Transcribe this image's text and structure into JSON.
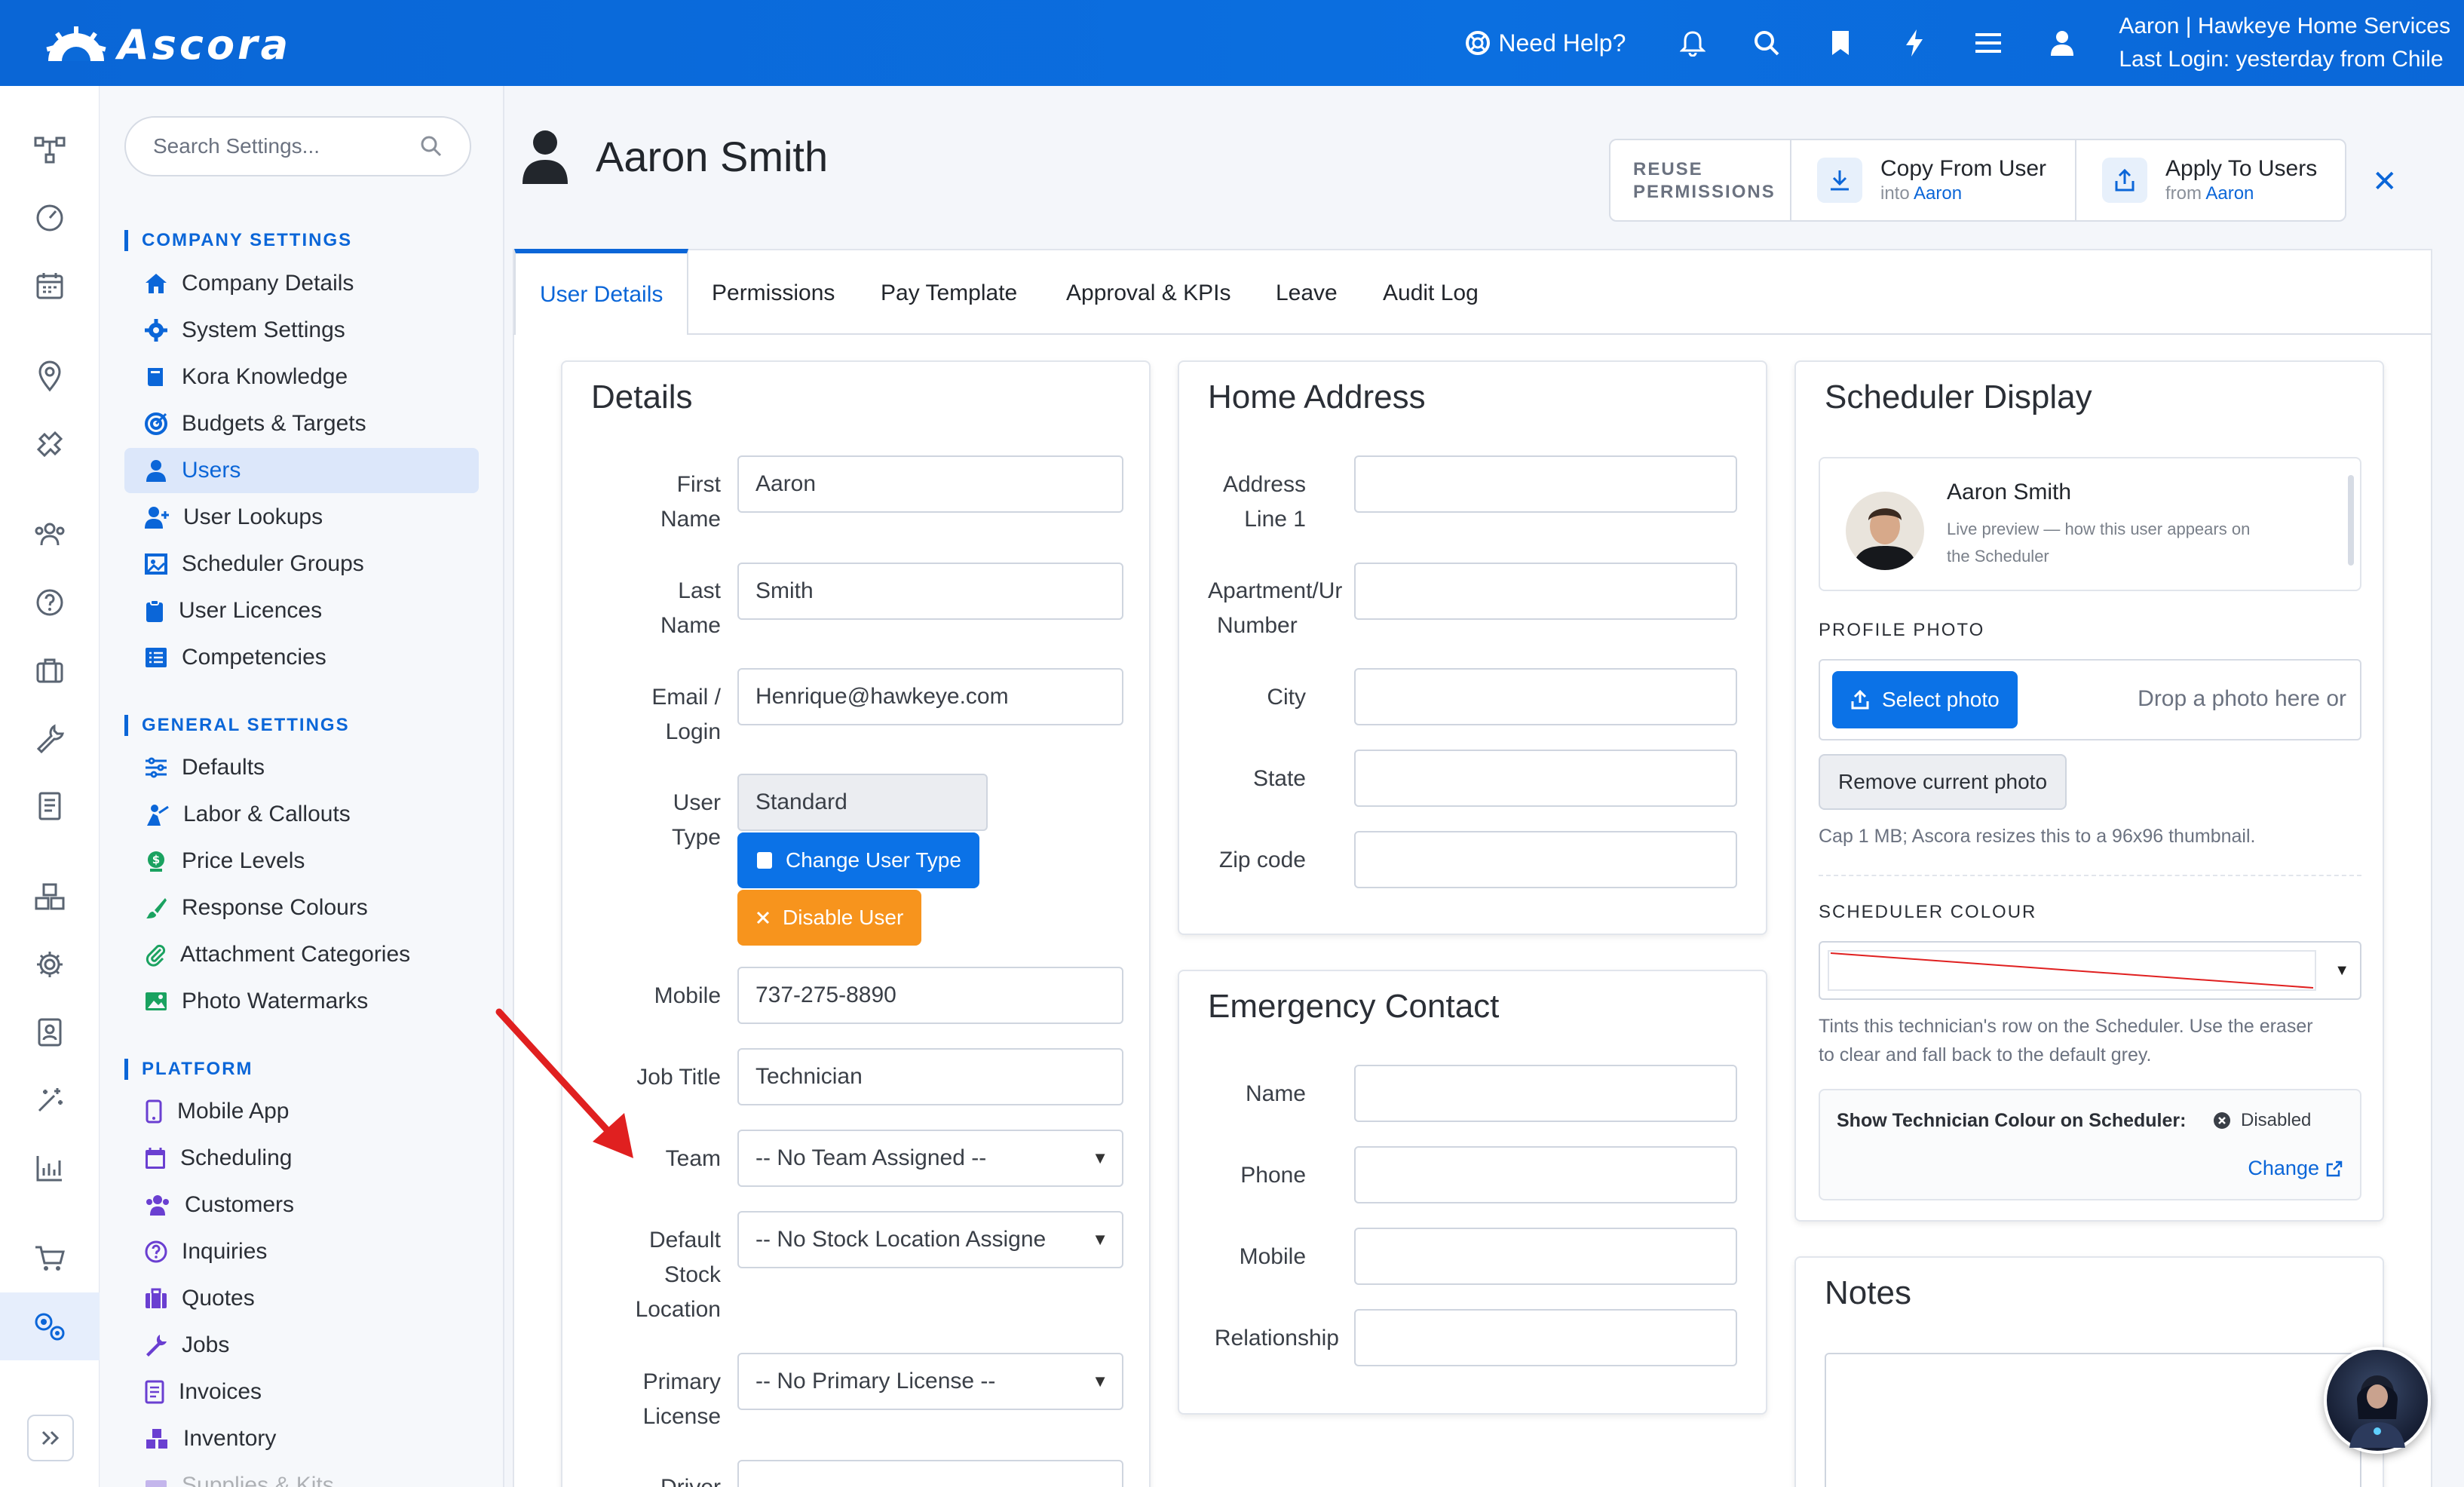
{
  "brand": {
    "name": "Ascora"
  },
  "topbar": {
    "help_label": "Need Help?",
    "user_line1": "Aaron | Hawkeye Home Services",
    "user_line2": "Last Login: yesterday from Chile",
    "icons": [
      "bell-icon",
      "search-icon",
      "bookmark-icon",
      "lightning-icon",
      "menu-icon",
      "user-icon"
    ]
  },
  "search": {
    "placeholder": "Search Settings..."
  },
  "nav": {
    "company_title": "COMPANY SETTINGS",
    "company": [
      "Company Details",
      "System Settings",
      "Kora Knowledge",
      "Budgets & Targets",
      "Users",
      "User Lookups",
      "Scheduler Groups",
      "User Licences",
      "Competencies"
    ],
    "general_title": "GENERAL SETTINGS",
    "general": [
      "Defaults",
      "Labor & Callouts",
      "Price Levels",
      "Response Colours",
      "Attachment Categories",
      "Photo Watermarks"
    ],
    "platform_title": "PLATFORM",
    "platform": [
      "Mobile App",
      "Scheduling",
      "Customers",
      "Inquiries",
      "Quotes",
      "Jobs",
      "Invoices",
      "Inventory",
      "Supplies & Kits"
    ],
    "active": "Users"
  },
  "page": {
    "title": "Aaron Smith"
  },
  "reuse": {
    "label_line1": "REUSE",
    "label_line2": "PERMISSIONS",
    "copy_title": "Copy From User",
    "copy_sub_prefix": "into",
    "copy_sub_name": "Aaron",
    "apply_title": "Apply To Users",
    "apply_sub_prefix": "from",
    "apply_sub_name": "Aaron"
  },
  "tabs": [
    "User Details",
    "Permissions",
    "Pay Template",
    "Approval & KPIs",
    "Leave",
    "Audit Log"
  ],
  "details": {
    "title": "Details",
    "first_name_label_1": "First",
    "first_name_label_2": "Name",
    "first_name": "Aaron",
    "last_name_label_1": "Last",
    "last_name_label_2": "Name",
    "last_name": "Smith",
    "email_label_1": "Email /",
    "email_label_2": "Login",
    "email": "Henrique@hawkeye.com",
    "user_type_label_1": "User",
    "user_type_label_2": "Type",
    "user_type": "Standard",
    "change_type_btn": "Change User Type",
    "disable_btn": "Disable User",
    "mobile_label": "Mobile",
    "mobile": "737-275-8890",
    "job_title_label": "Job Title",
    "job_title": "Technician",
    "team_label": "Team",
    "team": "-- No Team Assigned --",
    "stock_label_1": "Default",
    "stock_label_2": "Stock",
    "stock_label_3": "Location",
    "stock": "-- No Stock Location Assigne",
    "license_label_1": "Primary",
    "license_label_2": "License",
    "license": "-- No Primary License --",
    "driver_label": "Driver"
  },
  "home": {
    "title": "Home Address",
    "addr1_label_1": "Address",
    "addr1_label_2": "Line 1",
    "apt_label_1": "Apartment/Ur",
    "apt_label_2": "Number",
    "city_label": "City",
    "state_label": "State",
    "zip_label": "Zip code"
  },
  "emergency": {
    "title": "Emergency Contact",
    "name_label": "Name",
    "phone_label": "Phone",
    "mobile_label": "Mobile",
    "relationship_label": "Relationship"
  },
  "scheduler": {
    "title": "Scheduler Display",
    "preview_name": "Aaron Smith",
    "preview_sub_1": "Live preview — how this user appears on",
    "preview_sub_2": "the Scheduler",
    "photo_label": "PROFILE PHOTO",
    "select_photo_btn": "Select photo",
    "drop_text": "Drop a photo here or",
    "remove_photo_btn": "Remove current photo",
    "cap_text": "Cap 1 MB; Ascora resizes this to a 96x96 thumbnail.",
    "colour_label": "SCHEDULER COLOUR",
    "tint_text_1": "Tints this technician's row on the Scheduler. Use the eraser",
    "tint_text_2": "to clear and fall back to the default grey.",
    "show_colour_label": "Show Technician Colour on Scheduler:",
    "show_colour_status": "Disabled",
    "change_link": "Change"
  },
  "notes": {
    "title": "Notes"
  },
  "colors": {
    "brand_blue": "#0b66d8",
    "orange": "#f7941d",
    "annotation_arrow": "#e02020"
  }
}
